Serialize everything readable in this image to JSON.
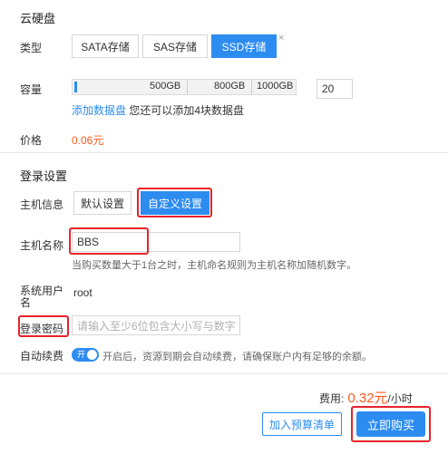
{
  "cloud_disk": {
    "section_title": "云硬盘",
    "type_label": "类型",
    "types": [
      "SATA存储",
      "SAS存储",
      "SSD存储"
    ],
    "selected_type": "SSD存储",
    "close_glyph": "×",
    "capacity_label": "容量",
    "capacity_marks": [
      "500GB",
      "800GB",
      "1000GB"
    ],
    "capacity_value": "20",
    "add_disk_link": "添加数据盘",
    "add_disk_hint": "您还可以添加4块数据盘",
    "price_label": "价格",
    "price_value": "0.06元"
  },
  "login": {
    "section_title": "登录设置",
    "host_info_label": "主机信息",
    "host_options": [
      "默认设置",
      "自定义设置"
    ],
    "selected_host_option": "自定义设置",
    "hostname_label": "主机名称",
    "hostname_value": "BBS",
    "hostname_hint": "当购买数量大于1台之时，主机命名规则为主机名称加随机数字。",
    "sys_user_label": "系统用户名",
    "sys_user_value": "root",
    "password_label": "登录密码",
    "password_placeholder": "请输入至少6位包含大小写与数字",
    "auto_renew_label": "自动续费",
    "auto_renew_toggle_text": "开",
    "auto_renew_hint": "开启后，资源到期会自动续费，请确保账户内有足够的余额。"
  },
  "footer": {
    "fee_label": "费用:",
    "fee_value": "0.32元",
    "fee_unit": "/小时",
    "add_budget_button": "加入预算清单",
    "buy_button": "立即购买"
  },
  "colors": {
    "accent": "#2d8cf0",
    "price": "#ff5a1f",
    "highlight_box": "#e8222a"
  }
}
